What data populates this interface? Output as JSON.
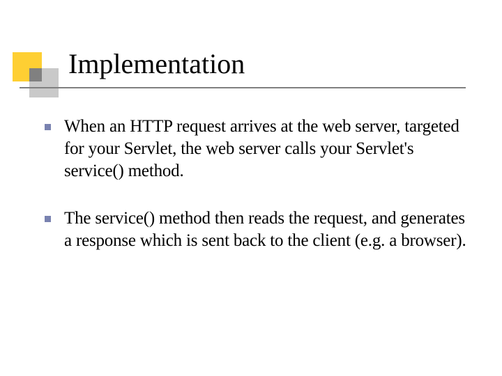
{
  "title": "Implementation",
  "bullets": [
    "When an HTTP request arrives at the web server, targeted for your Servlet, the web server calls your Servlet's service() method.",
    "The service() method then reads the  request, and generates a response which is  sent back to the client (e.g. a browser)."
  ]
}
